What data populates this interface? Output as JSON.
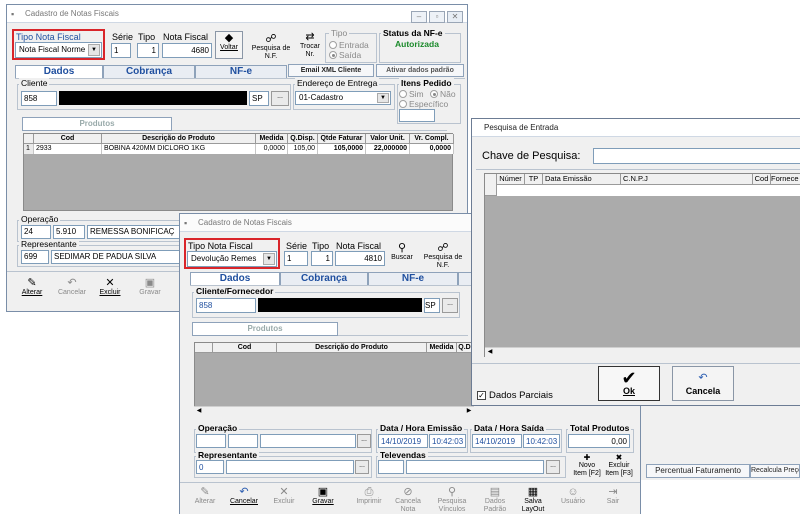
{
  "win1": {
    "title": "Cadastro de Notas Fiscais",
    "win_controls": [
      "–",
      "▫",
      "✕"
    ],
    "tipo_nota_fiscal": {
      "label": "Tipo Nota Fiscal",
      "value": "Nota Fiscal Norme"
    },
    "serie": {
      "label": "Série",
      "value": "1"
    },
    "tipo": {
      "label": "Tipo",
      "value": "1"
    },
    "nota_fiscal": {
      "label": "Nota Fiscal",
      "value": "4680"
    },
    "btn_voltar": "Voltar",
    "btn_pesquisa_nf": "Pesquisa de N.F.",
    "btn_trocar_nr": "Trocar Nr.",
    "tipo_group": {
      "label": "Tipo",
      "entrada": "Entrada",
      "saida": "Saída"
    },
    "status": {
      "label": "Status da NF-e",
      "value": "Autorizada"
    },
    "tabs": [
      "Dados",
      "Cobrança",
      "NF-e"
    ],
    "email_xml": "Email XML Cliente",
    "ativar_padrao": "Ativar dados padrão",
    "cliente": {
      "label": "Cliente",
      "code": "858",
      "uf": "SP",
      "more": "..."
    },
    "endereco": {
      "label": "Endereço de Entrega",
      "value": "01-Cadastro"
    },
    "itens_pedido": {
      "label": "Itens Pedido",
      "sim": "Sim",
      "nao": "Não",
      "especifico": "Específico"
    },
    "produtos_tab": "Produtos",
    "grid_headers": [
      "Cod",
      "Descrição do Produto",
      "Medida",
      "Q.Disp.",
      "Qtde Faturar",
      "Valor Unit.",
      "Vr. Compl."
    ],
    "grid_row": [
      "1",
      "2933",
      "BOBINA 420MM DICLORO 1KG",
      "0,0000",
      "105,00",
      "105,0000",
      "22,000000",
      "0,0000"
    ],
    "operacao": {
      "label": "Operação",
      "code": "24",
      "cfop": "5.910",
      "desc": "REMESSA BONIFICAÇ"
    },
    "representante": {
      "label": "Representante",
      "code": "699",
      "name": "SEDIMAR DE PADUA SILVA"
    },
    "toolbar": [
      "Alterar",
      "Cancelar",
      "Excluir",
      "Gravar"
    ]
  },
  "win2": {
    "title": "Cadastro de Notas Fiscais",
    "tipo_nota_fiscal": {
      "label": "Tipo Nota Fiscal",
      "value": "Devolução Remes"
    },
    "serie": {
      "label": "Série",
      "value": "1"
    },
    "tipo": {
      "label": "Tipo",
      "value": "1"
    },
    "nota_fiscal": {
      "label": "Nota Fiscal",
      "value": "4810"
    },
    "btn_buscar": "Buscar",
    "btn_pesquisa_nf": "Pesquisa de N.F.",
    "tabs": [
      "Dados",
      "Cobrança",
      "NF-e"
    ],
    "cliente": {
      "label": "Cliente/Fornecedor",
      "code": "858",
      "uf": "SP",
      "more": "..."
    },
    "produtos_tab": "Produtos",
    "grid_headers": [
      "Cod",
      "Descrição do Produto",
      "Medida",
      "Q.Di"
    ],
    "operacao": {
      "label": "Operação",
      "more": "..."
    },
    "data_emissao": {
      "label": "Data / Hora Emissão",
      "date": "14/10/2019",
      "time": "10:42:03"
    },
    "data_saida": {
      "label": "Data / Hora Saída",
      "date": "14/10/2019",
      "time": "10:42:03"
    },
    "total_produtos": {
      "label": "Total Produtos",
      "value": "0,00"
    },
    "representante": {
      "label": "Representante",
      "code": "0",
      "more": "..."
    },
    "televendas": {
      "label": "Televendas",
      "more": "..."
    },
    "btn_novo_item": "Novo Item [F2]",
    "btn_excluir_item": "Excluir Item [F3]",
    "toolbar": [
      "Alterar",
      "Cancelar",
      "Excluir",
      "Gravar",
      "Imprimir",
      "Cancela Nota",
      "Pesquisa Vínculos",
      "Dados Padrão",
      "Salva LayOut",
      "Usuário",
      "Sair"
    ]
  },
  "win3": {
    "title": "Pesquisa de Entrada",
    "chave_label": "Chave de Pesquisa:",
    "grid_headers": [
      "Númer",
      "TP",
      "Data Emissão",
      "C.N.P.J",
      "Cod",
      "Fornece"
    ],
    "dados_parciais": "Dados Parciais",
    "btn_ok": "Ok",
    "btn_cancela": "Cancela"
  },
  "bg_tabs": [
    "Percentual Faturamento",
    "Recalcula Preço"
  ]
}
